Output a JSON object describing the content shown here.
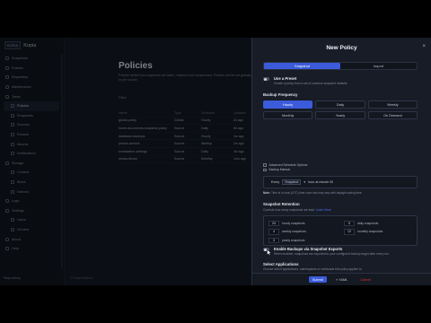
{
  "app": {
    "brand_box": "KOPIA",
    "brand_name": "Kopia"
  },
  "sidebar": {
    "items": [
      {
        "label": "Snapshots",
        "sub": false,
        "active": false
      },
      {
        "label": "Policies",
        "sub": false,
        "active": false
      },
      {
        "label": "Repository",
        "sub": false,
        "active": false
      },
      {
        "label": "Maintenance",
        "sub": false,
        "active": false
      },
      {
        "label": "Tasks",
        "sub": false,
        "active": false
      },
      {
        "label": "Policies",
        "sub": true,
        "active": true
      },
      {
        "label": "Snapshots",
        "sub": true,
        "active": false
      },
      {
        "label": "Sources",
        "sub": true,
        "active": false
      },
      {
        "label": "Restore",
        "sub": true,
        "active": false
      },
      {
        "label": "Mounts",
        "sub": true,
        "active": false
      },
      {
        "label": "Notifications",
        "sub": true,
        "active": false
      },
      {
        "label": "Storage",
        "sub": false,
        "active": false
      },
      {
        "label": "Content",
        "sub": true,
        "active": false
      },
      {
        "label": "Blobs",
        "sub": true,
        "active": false
      },
      {
        "label": "Indexes",
        "sub": true,
        "active": false
      },
      {
        "label": "Logs",
        "sub": false,
        "active": false
      },
      {
        "label": "Settings",
        "sub": false,
        "active": false
      },
      {
        "label": "Users",
        "sub": true,
        "active": false
      },
      {
        "label": "Servers",
        "sub": true,
        "active": false
      },
      {
        "label": "About",
        "sub": false,
        "active": false
      },
      {
        "label": "Help",
        "sub": false,
        "active": false
      }
    ],
    "footer": "Repository"
  },
  "page": {
    "title": "Policies",
    "description": "Policies define how snapshots are taken, retained and compressed. Policies can be set globally or per source.",
    "filter": "Filter",
    "table": {
      "headers": [
        "Name",
        "Type",
        "Schedule",
        "Updated"
      ],
      "rows": [
        [
          "global-policy",
          "Global",
          "Hourly",
          "2d ago"
        ],
        [
          "home-documents-snapshot-policy",
          "Source",
          "Daily",
          "5d ago"
        ],
        [
          "database-backups",
          "Source",
          "Hourly",
          "1w ago"
        ],
        [
          "photos-archive",
          "Source",
          "Weekly",
          "2w ago"
        ],
        [
          "workstation-settings",
          "Source",
          "Daily",
          "3w ago"
        ],
        [
          "media-library",
          "Source",
          "Monthly",
          "1mo ago"
        ]
      ]
    },
    "footer": "© Kopia Authors"
  },
  "modal": {
    "title": "New Policy",
    "close": "×",
    "tabs": [
      {
        "label": "Snapshot",
        "active": true
      },
      {
        "label": "Import",
        "active": false
      }
    ],
    "preset": {
      "title": "Use a Preset",
      "subtitle": "Create a policy from a set of common snapshot defaults"
    },
    "frequency": {
      "title": "Backup Frequency",
      "options": [
        {
          "label": "Hourly",
          "active": true
        },
        {
          "label": "Daily",
          "active": false
        },
        {
          "label": "Weekly",
          "active": false
        },
        {
          "label": "Monthly",
          "active": false
        },
        {
          "label": "Yearly",
          "active": false
        },
        {
          "label": "On Demand",
          "active": false
        }
      ],
      "checks": [
        "Advanced Schedule Options",
        "Backup Manual"
      ],
      "schedule_prefix": "Every",
      "schedule_select": "Snapshot",
      "schedule_suffix": "hour at minute 00",
      "note_label": "Note:",
      "note_text": "Time is in local (UTC) time zone and may vary with daylight saving time."
    },
    "retention": {
      "title": "Snapshot Retention",
      "subtitle": "Controls how many snapshots are kept.",
      "subtitle_link": "Learn More",
      "items": [
        {
          "value": "24",
          "label": "hourly snapshots"
        },
        {
          "value": "5",
          "label": "daily snapshots"
        },
        {
          "value": "4",
          "label": "weekly snapshots"
        },
        {
          "value": "12",
          "label": "monthly snapshots"
        },
        {
          "value": "3",
          "label": "yearly snapshots"
        }
      ]
    },
    "enable": {
      "title": "Enable Backups via Snapshot Exports",
      "subtitle": "When enabled, snapshots are exported to your configured backup target after every run."
    },
    "applications": {
      "title": "Select Applications",
      "subtitle": "Choose which applications, namespaces or workloads this policy applies to.",
      "options": [
        {
          "label": "By Name",
          "active": true
        },
        {
          "label": "By Labels",
          "active": false
        },
        {
          "label": "None",
          "active": false
        }
      ],
      "hint": "Choose one or more applications to continue."
    },
    "footer": {
      "submit": "Submit",
      "yaml": "YAML",
      "cancel": "Cancel"
    }
  }
}
